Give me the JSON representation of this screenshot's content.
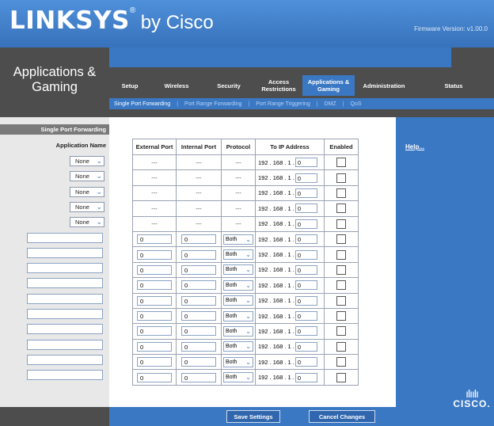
{
  "header": {
    "brand": "LINKSYS",
    "reg": "®",
    "sub": "by Cisco",
    "firmware": "Firmware Version: v1.00.0"
  },
  "band": {
    "title_line1": "Applications &",
    "title_line2": "Gaming"
  },
  "tabs": [
    {
      "label": "Setup",
      "active": false
    },
    {
      "label": "Wireless",
      "active": false
    },
    {
      "label": "Security",
      "active": false
    },
    {
      "label": "Access Restrictions",
      "active": false
    },
    {
      "label": "Applications & Gaming",
      "active": true
    },
    {
      "label": "Administration",
      "active": false
    },
    {
      "label": "Status",
      "active": false
    }
  ],
  "subtabs": [
    {
      "label": "Single Port Forwarding",
      "active": true
    },
    {
      "label": "Port Range Forwarding",
      "active": false
    },
    {
      "label": "Port Range Triggering",
      "active": false
    },
    {
      "label": "DMZ",
      "active": false
    },
    {
      "label": "QoS",
      "active": false
    }
  ],
  "subtab_separator": "|",
  "left": {
    "section_title": "Single Port Forwarding",
    "app_name_header": "Application Name",
    "presets": [
      "None",
      "None",
      "None",
      "None",
      "None"
    ],
    "custom_rows": 10
  },
  "table": {
    "headers": [
      "External Port",
      "Internal Port",
      "Protocol",
      "To IP Address",
      "Enabled"
    ],
    "dash": "---",
    "ip_prefix": "192 . 168 . 1 .",
    "ip_last": "0",
    "port_value": "0",
    "protocol": "Both",
    "preset_rows": 5,
    "custom_rows": 10
  },
  "right": {
    "help_label": "Help..."
  },
  "footer": {
    "save_label": "Save Settings",
    "cancel_label": "Cancel Changes"
  },
  "logo": {
    "bars": "ılıılı",
    "text": "CISCO."
  },
  "colors": {
    "accent_blue": "#3a78c4",
    "dark_gray": "#4d4d4d"
  }
}
